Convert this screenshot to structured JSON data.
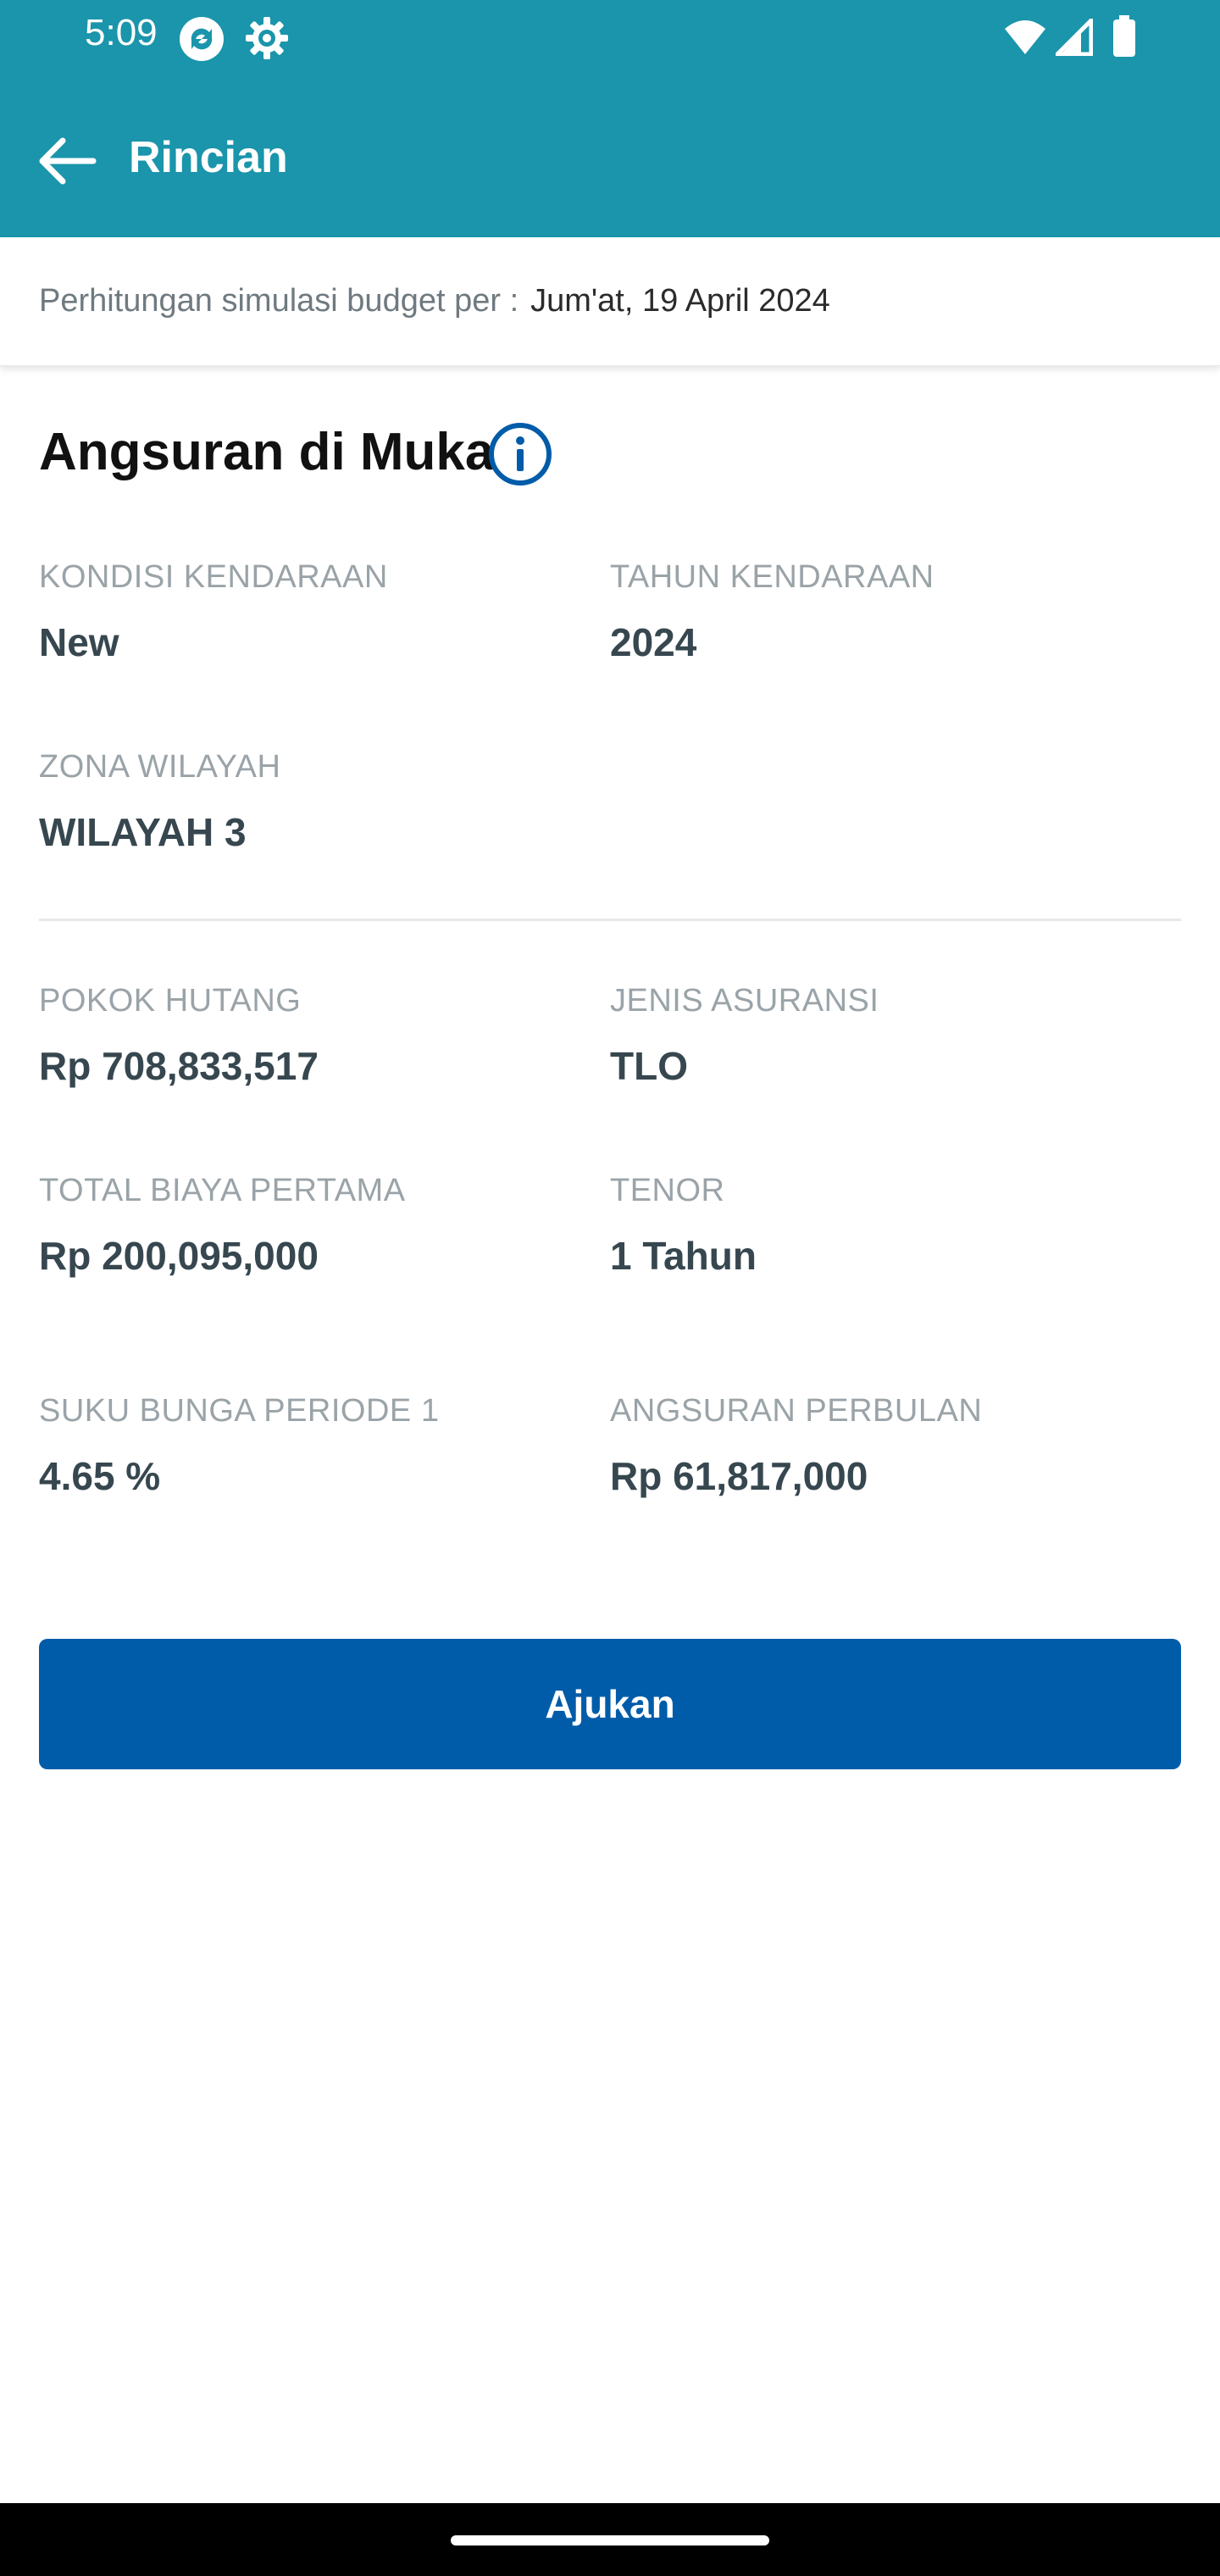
{
  "status_bar": {
    "time": "5:09",
    "icons": [
      "sync-icon",
      "settings-icon",
      "wifi-icon",
      "signal-icon",
      "battery-icon"
    ]
  },
  "app_bar": {
    "back_icon": "arrow-left-icon",
    "title": "Rincian"
  },
  "simulation_date": {
    "label": "Perhitungan simulasi budget per :",
    "value": "Jum'at, 19 April 2024"
  },
  "section": {
    "title": "Angsuran di Muka",
    "info_icon": "info-icon"
  },
  "fields": {
    "kondisi": {
      "label": "KONDISI KENDARAAN",
      "value": "New"
    },
    "tahun": {
      "label": "TAHUN KENDARAAN",
      "value": "2024"
    },
    "zona": {
      "label": "ZONA WILAYAH",
      "value": "WILAYAH 3"
    },
    "pokok": {
      "label": "POKOK HUTANG",
      "value": "Rp 708,833,517"
    },
    "asuransi": {
      "label": "JENIS ASURANSI",
      "value": "TLO"
    },
    "biaya": {
      "label": "TOTAL BIAYA PERTAMA",
      "value": "Rp 200,095,000"
    },
    "tenor": {
      "label": "TENOR",
      "value": "1 Tahun"
    },
    "bunga": {
      "label": "SUKU BUNGA PERIODE 1",
      "value": "4.65 %"
    },
    "angsuran": {
      "label": "ANGSURAN PERBULAN",
      "value": "Rp 61,817,000"
    }
  },
  "actions": {
    "submit_label": "Ajukan"
  },
  "colors": {
    "app_bar": "#1a95ab",
    "primary_button": "#005ca9",
    "label_text": "#9aa3a8",
    "value_text": "#37474f"
  }
}
